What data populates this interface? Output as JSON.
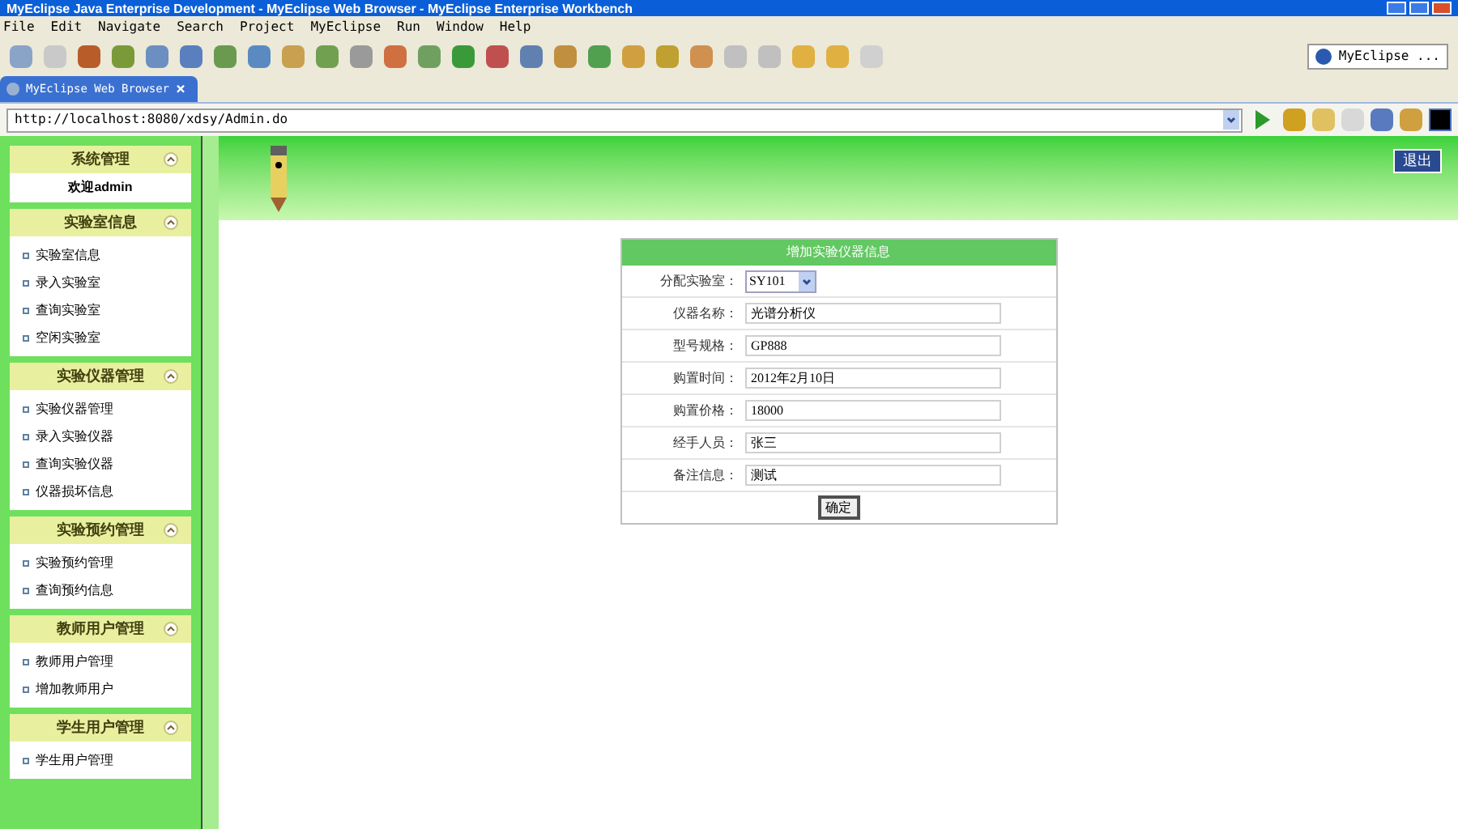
{
  "window": {
    "title": "MyEclipse Java Enterprise Development - MyEclipse Web Browser - MyEclipse Enterprise Workbench"
  },
  "menu": [
    "File",
    "Edit",
    "Navigate",
    "Search",
    "Project",
    "MyEclipse",
    "Run",
    "Window",
    "Help"
  ],
  "perspective": {
    "label": "MyEclipse ..."
  },
  "tab": {
    "label": "MyEclipse Web Browser",
    "close": "×"
  },
  "address": {
    "value": "http://localhost:8080/xdsy/Admin.do"
  },
  "sidebar": [
    {
      "title": "系统管理",
      "expanded": true,
      "welcome": "欢迎admin"
    },
    {
      "title": "实验室信息",
      "expanded": true,
      "items": [
        "实验室信息",
        "录入实验室",
        "查询实验室",
        "空闲实验室"
      ]
    },
    {
      "title": "实验仪器管理",
      "expanded": true,
      "items": [
        "实验仪器管理",
        "录入实验仪器",
        "查询实验仪器",
        "仪器损坏信息"
      ]
    },
    {
      "title": "实验预约管理",
      "expanded": true,
      "items": [
        "实验预约管理",
        "查询预约信息"
      ]
    },
    {
      "title": "教师用户管理",
      "expanded": true,
      "items": [
        "教师用户管理",
        "增加教师用户"
      ]
    },
    {
      "title": "学生用户管理",
      "expanded": true,
      "items": [
        "学生用户管理"
      ]
    }
  ],
  "logout": "退出",
  "form": {
    "title": "增加实验仪器信息",
    "fields": [
      {
        "kind": "select",
        "label": "分配实验室：",
        "value": "SY101"
      },
      {
        "kind": "text",
        "label": "仪器名称：",
        "value": "光谱分析仪"
      },
      {
        "kind": "text",
        "label": "型号规格：",
        "value": "GP888"
      },
      {
        "kind": "text",
        "label": "购置时间：",
        "value": "2012年2月10日"
      },
      {
        "kind": "text",
        "label": "购置价格：",
        "value": "18000"
      },
      {
        "kind": "text",
        "label": "经手人员：",
        "value": "张三"
      },
      {
        "kind": "text",
        "label": "备注信息：",
        "value": "测试"
      }
    ],
    "submit": "确定"
  }
}
